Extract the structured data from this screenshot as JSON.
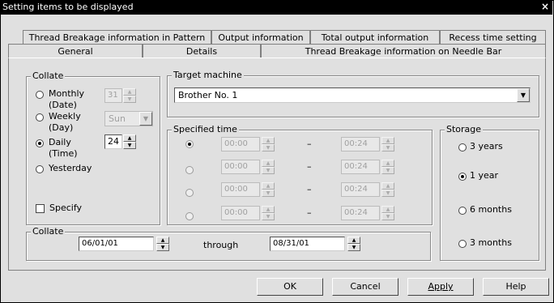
{
  "window": {
    "title": "Setting items to be displayed",
    "close_glyph": "×"
  },
  "tabs": {
    "row1": [
      "Thread Breakage information in Pattern",
      "Output information",
      "Total output information",
      "Recess time setting"
    ],
    "row2": [
      "General",
      "Details",
      "Thread Breakage information on Needle Bar"
    ],
    "active": "General"
  },
  "collate_group": {
    "title": "Collate",
    "options": [
      {
        "label": "Monthly",
        "sub": "(Date)",
        "selected": false,
        "value": "31"
      },
      {
        "label": "Weekly",
        "sub": "(Day)",
        "selected": false,
        "value": "Sun"
      },
      {
        "label": "Daily",
        "sub": "(Time)",
        "selected": true,
        "value": "24"
      },
      {
        "label": "Yesterday",
        "sub": "",
        "selected": false,
        "value": ""
      }
    ],
    "specify_label": "Specify",
    "specify_checked": false
  },
  "target_machine": {
    "title": "Target machine",
    "value": "Brother No. 1"
  },
  "specified_time": {
    "title": "Specified time",
    "separator": "–",
    "rows": [
      {
        "from": "00:00",
        "to": "00:24",
        "selected": true
      },
      {
        "from": "00:00",
        "to": "00:24",
        "selected": false
      },
      {
        "from": "00:00",
        "to": "00:24",
        "selected": false
      },
      {
        "from": "00:00",
        "to": "00:24",
        "selected": false
      }
    ]
  },
  "storage": {
    "title": "Storage",
    "options": [
      {
        "label": "3 years",
        "selected": false
      },
      {
        "label": "1 year",
        "selected": true
      },
      {
        "label": "6 months",
        "selected": false
      },
      {
        "label": "3 months",
        "selected": false
      }
    ]
  },
  "collate_range": {
    "title": "Collate",
    "from": "06/01/01",
    "through_label": "through",
    "to": "08/31/01"
  },
  "buttons": {
    "ok": "OK",
    "cancel": "Cancel",
    "apply": "Apply",
    "help": "Help"
  }
}
